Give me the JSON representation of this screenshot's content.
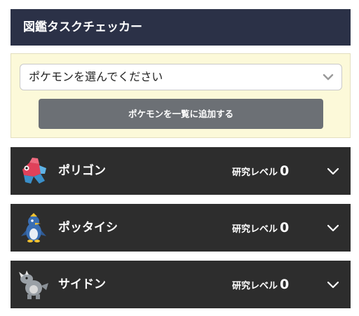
{
  "header": {
    "title": "図鑑タスクチェッカー"
  },
  "selector": {
    "placeholder_text": "ポケモンを選んでください",
    "add_button_label": "ポケモンを一覧に追加する"
  },
  "pokemon": [
    {
      "name": "ポリゴン",
      "level_label": "研究レベル",
      "level": "0",
      "icon": "porygon-sprite"
    },
    {
      "name": "ポッタイシ",
      "level_label": "研究レベル",
      "level": "0",
      "icon": "prinplup-sprite"
    },
    {
      "name": "サイドン",
      "level_label": "研究レベル",
      "level": "0",
      "icon": "rhydon-sprite"
    }
  ],
  "colors": {
    "header_bg": "#2b3147",
    "panel_bg": "#fcf9d9",
    "button_bg": "#6c7075",
    "row_bg": "#2d2d2d"
  }
}
